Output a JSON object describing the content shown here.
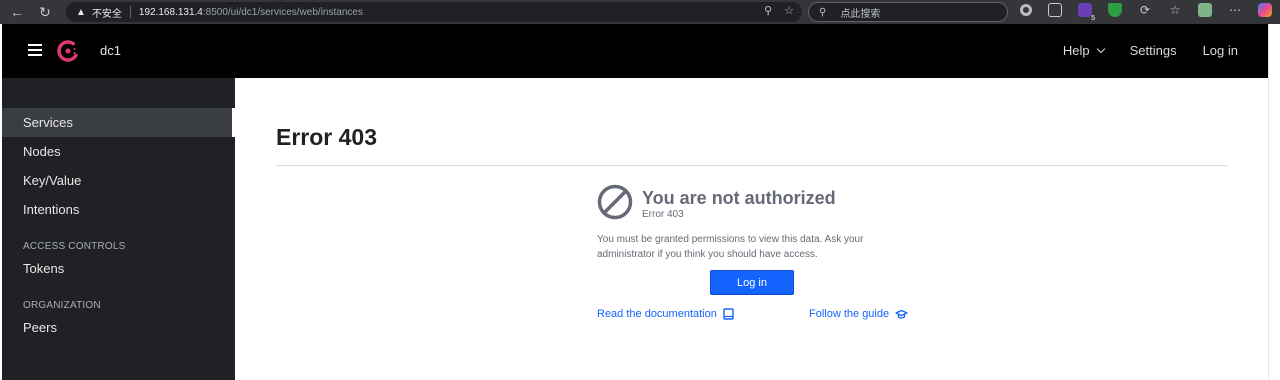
{
  "browser": {
    "insecure_label": "不安全",
    "url_host": "192.168.131.4",
    "url_path": ":8500/ui/dc1/services/web/instances",
    "search_placeholder": "点此搜索",
    "badge_count": "5"
  },
  "header": {
    "datacenter": "dc1",
    "nav": {
      "help": "Help",
      "settings": "Settings",
      "login": "Log in"
    },
    "logo_color": "#e03875"
  },
  "sidebar": {
    "items": [
      {
        "label": "Services"
      },
      {
        "label": "Nodes"
      },
      {
        "label": "Key/Value"
      },
      {
        "label": "Intentions"
      }
    ],
    "access_controls": {
      "heading": "ACCESS CONTROLS",
      "items": [
        {
          "label": "Tokens"
        }
      ]
    },
    "organization": {
      "heading": "ORGANIZATION",
      "items": [
        {
          "label": "Peers"
        }
      ]
    },
    "active": "Services"
  },
  "main": {
    "title": "Error 403",
    "error": {
      "heading": "You are not authorized",
      "code": "Error 403",
      "message": "You must be granted permissions to view this data. Ask your administrator if you think you should have access.",
      "login_button": "Log in",
      "doc_link": "Read the documentation",
      "guide_link": "Follow the guide"
    }
  },
  "colors": {
    "primary": "#1563ff",
    "text_muted": "#656a76",
    "header_bg": "#000000",
    "sidebar_bg": "#1f2124"
  }
}
